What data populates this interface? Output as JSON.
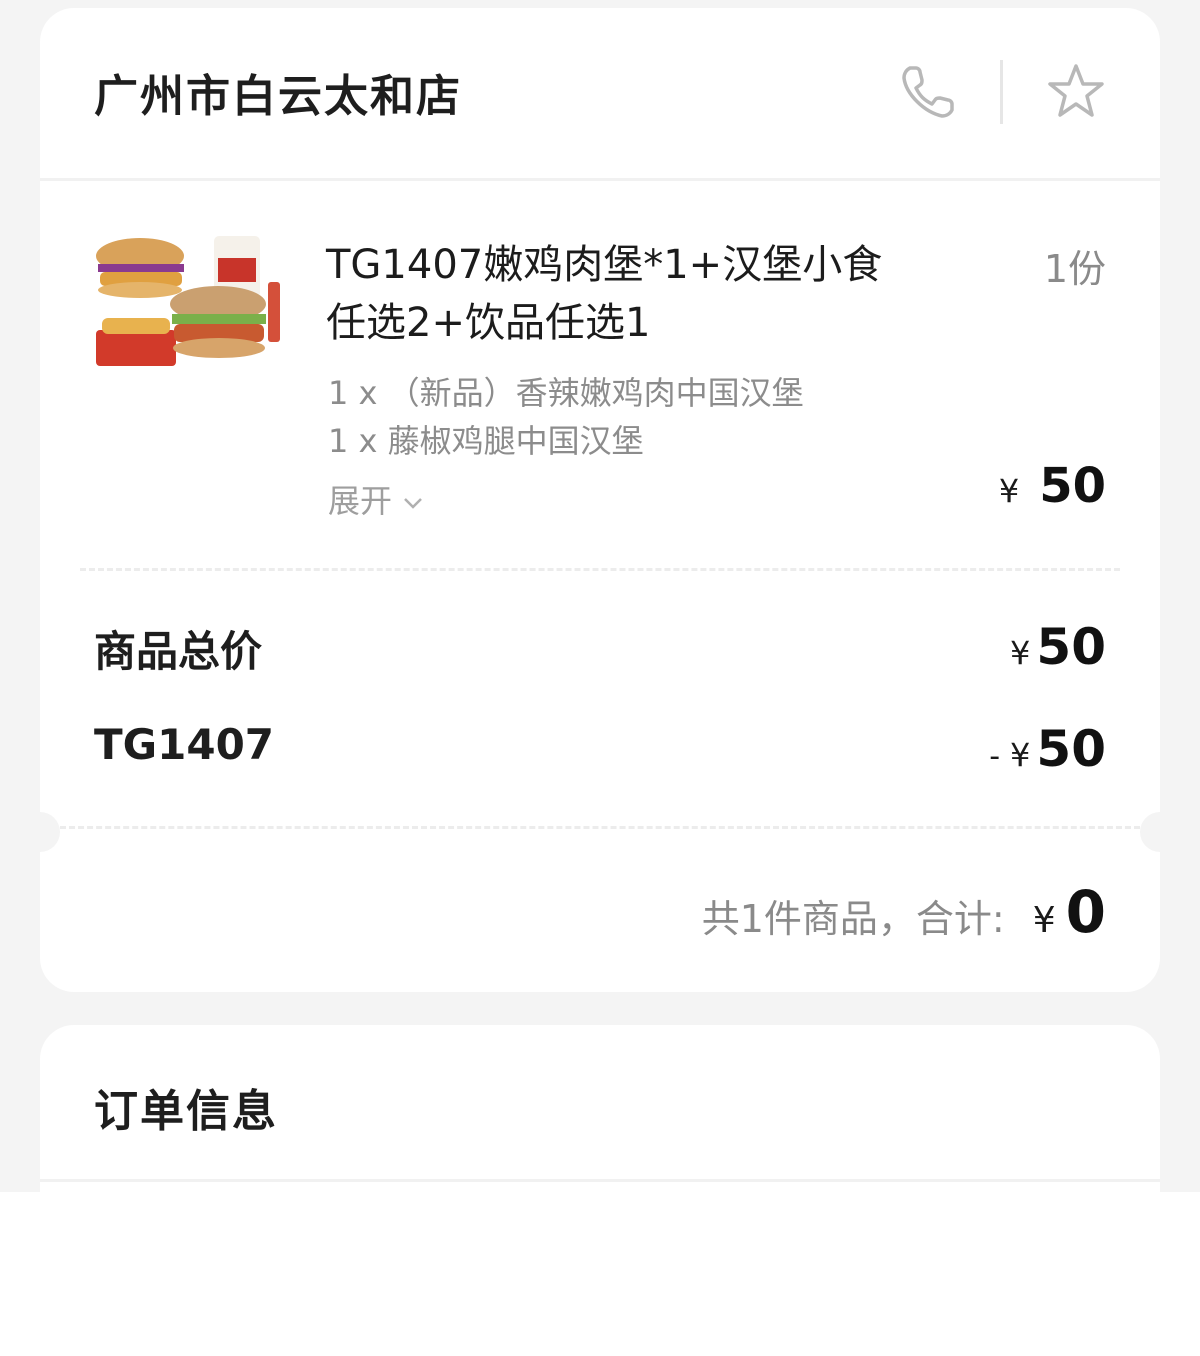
{
  "store": {
    "name": "广州市白云太和店",
    "phone_icon": "phone-icon",
    "star_icon": "star-outline-icon"
  },
  "product": {
    "title": "TG1407嫩鸡肉堡*1+汉堡小食任选2+饮品任选1",
    "quantity": "1份",
    "sub_items": [
      "1 x （新品）香辣嫩鸡肉中国汉堡",
      "1 x 藤椒鸡腿中国汉堡"
    ],
    "expand_label": "展开",
    "currency": "¥",
    "price": "50"
  },
  "summary": {
    "goods_total_label": "商品总价",
    "goods_total_currency": "¥",
    "goods_total_value": "50",
    "discount_label": "TG1407",
    "discount_sign": "-",
    "discount_currency": "¥",
    "discount_value": "50"
  },
  "total": {
    "label": "共1件商品，合计:",
    "currency": "¥",
    "value": "0"
  },
  "order_info": {
    "title": "订单信息"
  },
  "colors": {
    "background": "#f4f4f4",
    "card": "#ffffff",
    "primary_text": "#1a1a1a",
    "secondary_text": "#8a8a8a"
  }
}
